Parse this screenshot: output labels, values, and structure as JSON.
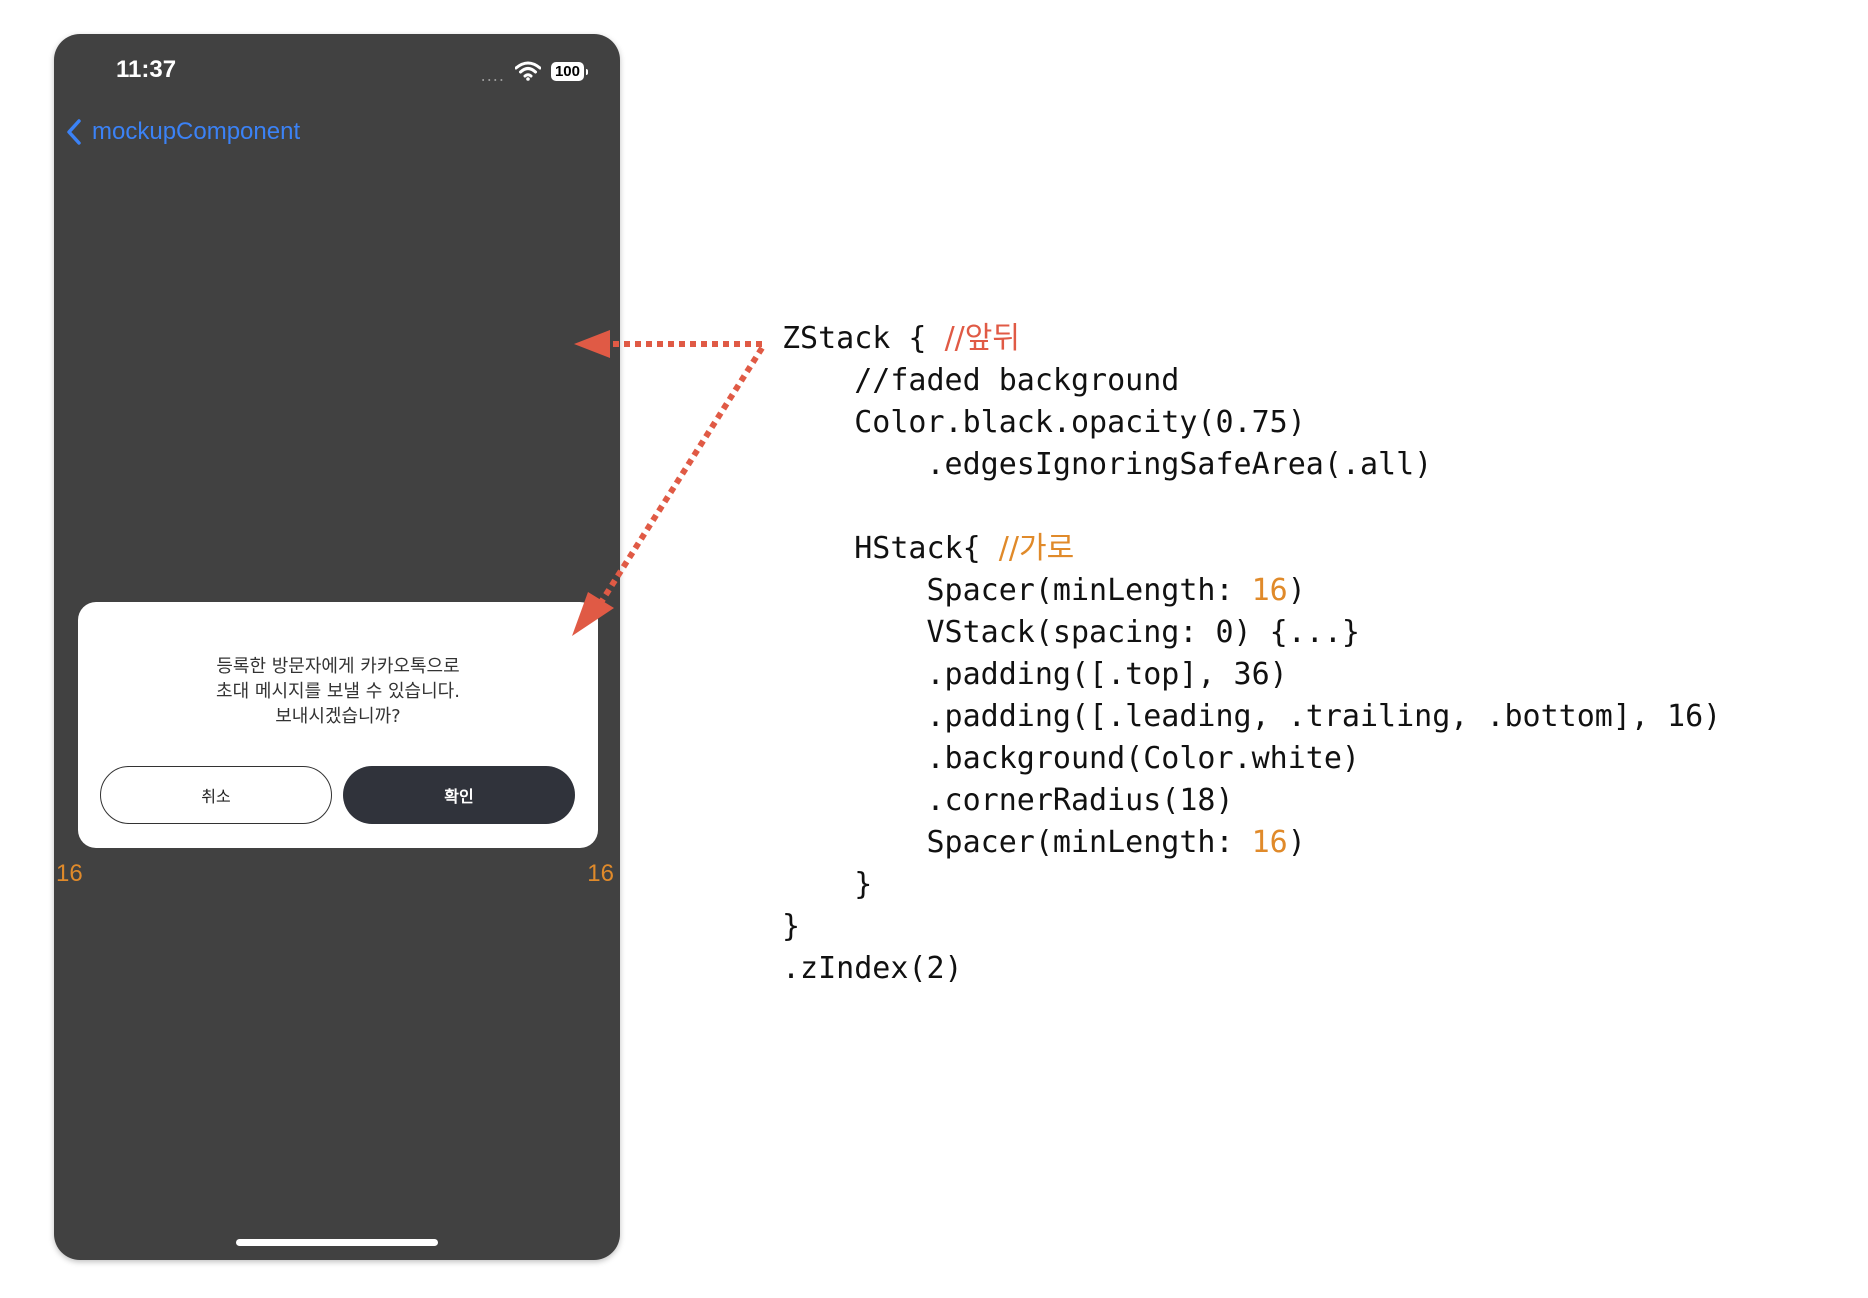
{
  "phone": {
    "status_time": "11:37",
    "signal_dots": "....",
    "battery": "100",
    "nav_back_label": "mockupComponent",
    "alert": {
      "message_lines": [
        "등록한 방문자에게 카카오톡으로",
        "초대 메시지를 보낼 수 있습니다.",
        "보내시겠습니까?"
      ],
      "cancel_label": "취소",
      "ok_label": "확인"
    },
    "margin_left_label": "16",
    "margin_right_label": "16"
  },
  "code": {
    "l1_code": "ZStack { ",
    "l1_comment": "//앞뒤",
    "l2": "    //faded background",
    "l3": "    Color.black.opacity(0.75)",
    "l4": "        .edgesIgnoringSafeArea(.all)",
    "l6_code": "    HStack{ ",
    "l6_comment": "//가로",
    "l7_pre": "        Spacer(minLength: ",
    "l7_num": "16",
    "l7_post": ")",
    "l8": "        VStack(spacing: 0) {...}",
    "l9": "        .padding([.top], 36)",
    "l10": "        .padding([.leading, .trailing, .bottom], 16)",
    "l11": "        .background(Color.white)",
    "l12": "        .cornerRadius(18)",
    "l13_pre": "        Spacer(minLength: ",
    "l13_num": "16",
    "l13_post": ")",
    "l14": "    }",
    "l15": "}",
    "l16": ".zIndex(2)"
  },
  "colors": {
    "phone_bg": "#414141",
    "accent_blue": "#3b82f6",
    "arrow_red": "#e05a45",
    "number_orange": "#e08a2a",
    "button_dark": "#30333b"
  }
}
